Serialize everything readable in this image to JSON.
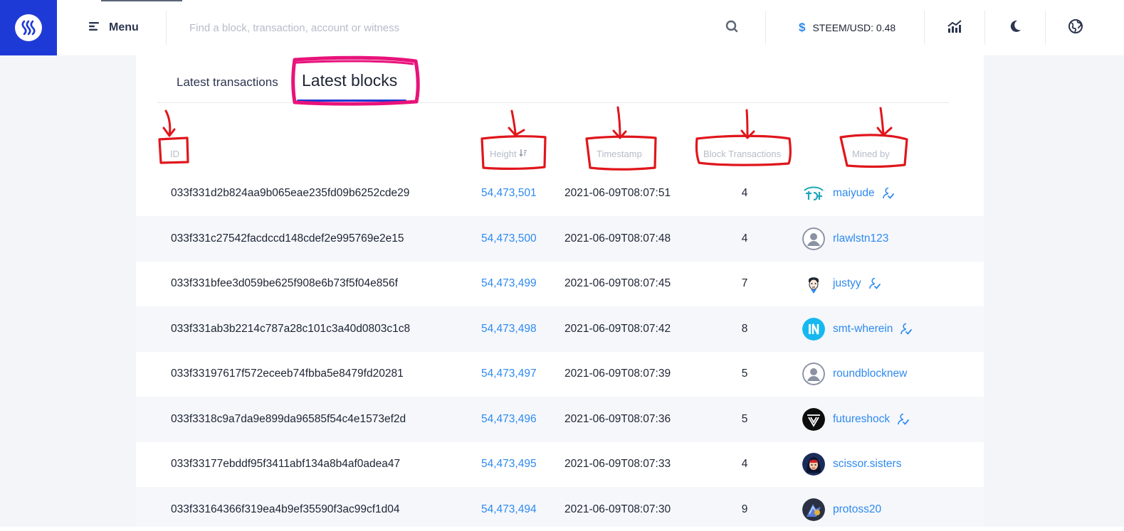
{
  "header": {
    "menu_label": "Menu",
    "search_placeholder": "Find a block, transaction, account or witness",
    "price_symbol": "$",
    "price_label": "STEEM/USD: 0.48"
  },
  "tabs": {
    "latest_transactions": "Latest transactions",
    "latest_blocks": "Latest blocks"
  },
  "columns": {
    "id": "ID",
    "height": "Height",
    "timestamp": "Timestamp",
    "block_transactions": "Block Transactions",
    "mined_by": "Mined by"
  },
  "blocks": [
    {
      "id": "033f331d2b824aa9b065eae235fd09b6252cde29",
      "height": "54,473,501",
      "timestamp": "2021-06-09T08:07:51",
      "tx": "4",
      "miner": "maiyude",
      "verified": true,
      "avatar": "maiyude"
    },
    {
      "id": "033f331c27542facdccd148cdef2e995769e2e15",
      "height": "54,473,500",
      "timestamp": "2021-06-09T08:07:48",
      "tx": "4",
      "miner": "rlawlstn123",
      "verified": false,
      "avatar": "default"
    },
    {
      "id": "033f331bfee3d059be625f908e6b73f5f04e856f",
      "height": "54,473,499",
      "timestamp": "2021-06-09T08:07:45",
      "tx": "7",
      "miner": "justyy",
      "verified": true,
      "avatar": "justyy"
    },
    {
      "id": "033f331ab3b2214c787a28c101c3a40d0803c1c8",
      "height": "54,473,498",
      "timestamp": "2021-06-09T08:07:42",
      "tx": "8",
      "miner": "smt-wherein",
      "verified": true,
      "avatar": "smt"
    },
    {
      "id": "033f33197617f572eceeb74fbba5e8479fd20281",
      "height": "54,473,497",
      "timestamp": "2021-06-09T08:07:39",
      "tx": "5",
      "miner": "roundblocknew",
      "verified": false,
      "avatar": "default"
    },
    {
      "id": "033f3318c9a7da9e899da96585f54c4e1573ef2d",
      "height": "54,473,496",
      "timestamp": "2021-06-09T08:07:36",
      "tx": "5",
      "miner": "futureshock",
      "verified": true,
      "avatar": "futureshock"
    },
    {
      "id": "033f33177ebddf95f3411abf134a8b4af0adea47",
      "height": "54,473,495",
      "timestamp": "2021-06-09T08:07:33",
      "tx": "4",
      "miner": "scissor.sisters",
      "verified": false,
      "avatar": "scissor"
    },
    {
      "id": "033f33164366f319ea4b9ef35590f3ac99cf1d04",
      "height": "54,473,494",
      "timestamp": "2021-06-09T08:07:30",
      "tx": "9",
      "miner": "protoss20",
      "verified": false,
      "avatar": "protoss"
    }
  ],
  "colors": {
    "brand": "#1e3ad6",
    "link": "#2e8af0",
    "annotation_red": "#e0161c",
    "annotation_magenta": "#e8137a"
  }
}
